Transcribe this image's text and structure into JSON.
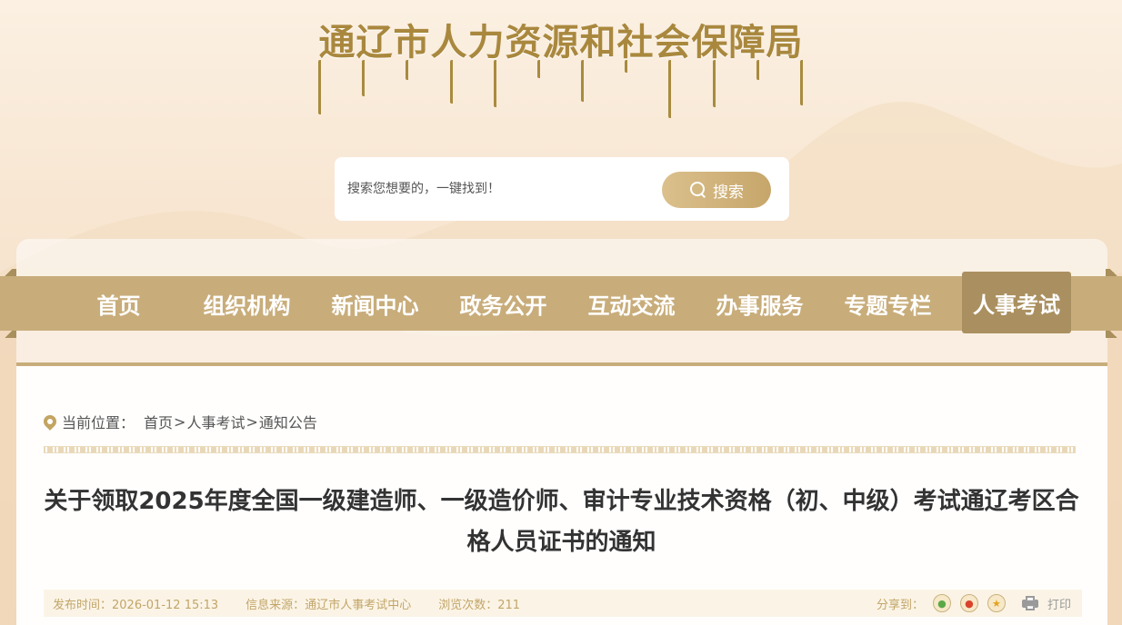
{
  "header": {
    "site_title": "通辽市人力资源和社会保障局"
  },
  "search": {
    "placeholder": "搜索您想要的，一键找到！",
    "button_label": "搜索"
  },
  "nav": {
    "items": [
      {
        "label": "首页"
      },
      {
        "label": "组织机构"
      },
      {
        "label": "新闻中心"
      },
      {
        "label": "政务公开"
      },
      {
        "label": "互动交流"
      },
      {
        "label": "办事服务"
      },
      {
        "label": "专题专栏"
      },
      {
        "label": "人事考试",
        "active": true
      }
    ]
  },
  "breadcrumb": {
    "prefix": "当前位置：",
    "items": [
      "首页",
      "人事考试",
      "通知公告"
    ],
    "sep": ">"
  },
  "article": {
    "title": "关于领取2025年度全国一级建造师、一级造价师、审计专业技术资格（初、中级）考试通辽考区合格人员证书的通知",
    "publish_label": "发布时间：",
    "publish_value": "2026-01-12 15:13",
    "source_label": "信息来源：",
    "source_value": "通辽市人事考试中心",
    "views_label": "浏览次数：",
    "views_value": "211",
    "share_label": "分享到：",
    "print_label": "打印"
  },
  "icons": {
    "search": "search-icon",
    "location": "location-pin-icon",
    "share": [
      "wechat-icon",
      "weibo-icon",
      "qzone-icon"
    ],
    "print": "print-icon"
  },
  "colors": {
    "brand_gold": "#a9883e",
    "nav_bg": "#c8ad7b",
    "nav_active": "#aa9060",
    "meta_text": "#c2a569"
  }
}
